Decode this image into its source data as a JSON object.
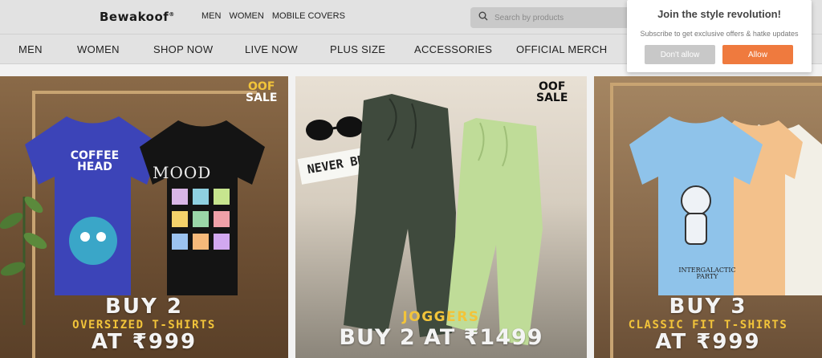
{
  "header": {
    "logo": "Bewakoof",
    "logo_mark": "®",
    "top_links": [
      "MEN",
      "WOMEN",
      "MOBILE COVERS"
    ],
    "search_placeholder": "Search by products"
  },
  "category_nav": [
    "MEN",
    "WOMEN",
    "SHOP NOW",
    "LIVE NOW",
    "PLUS SIZE",
    "ACCESSORIES",
    "OFFICIAL MERCH"
  ],
  "notification_popup": {
    "title": "Join the style revolution!",
    "subtitle": "Subscribe to get exclusive offers & hatke updates",
    "deny_label": "Don't allow",
    "allow_label": "Allow"
  },
  "banners": [
    {
      "badge_top": "OOF",
      "badge_bottom": "SALE",
      "title": "BUY 2",
      "subtitle": "OVERSIZED T-SHIRTS",
      "price": "AT ₹999",
      "shirt_text_1": "COFFEE HEAD",
      "shirt_text_2": "MOOD"
    },
    {
      "badge_top": "OOF",
      "badge_bottom": "SALE",
      "note_text": "NEVER BRING IT UP",
      "subtitle": "JOGGERS",
      "price": "BUY 2 AT ₹1499"
    },
    {
      "title": "BUY 3",
      "subtitle": "CLASSIC FIT T-SHIRTS",
      "price": "AT ₹999",
      "shirt_text": "INTERGALACTIC PARTY"
    }
  ],
  "colors": {
    "accent_orange": "#ef7a3e",
    "promo_yellow": "#f2c43a"
  }
}
